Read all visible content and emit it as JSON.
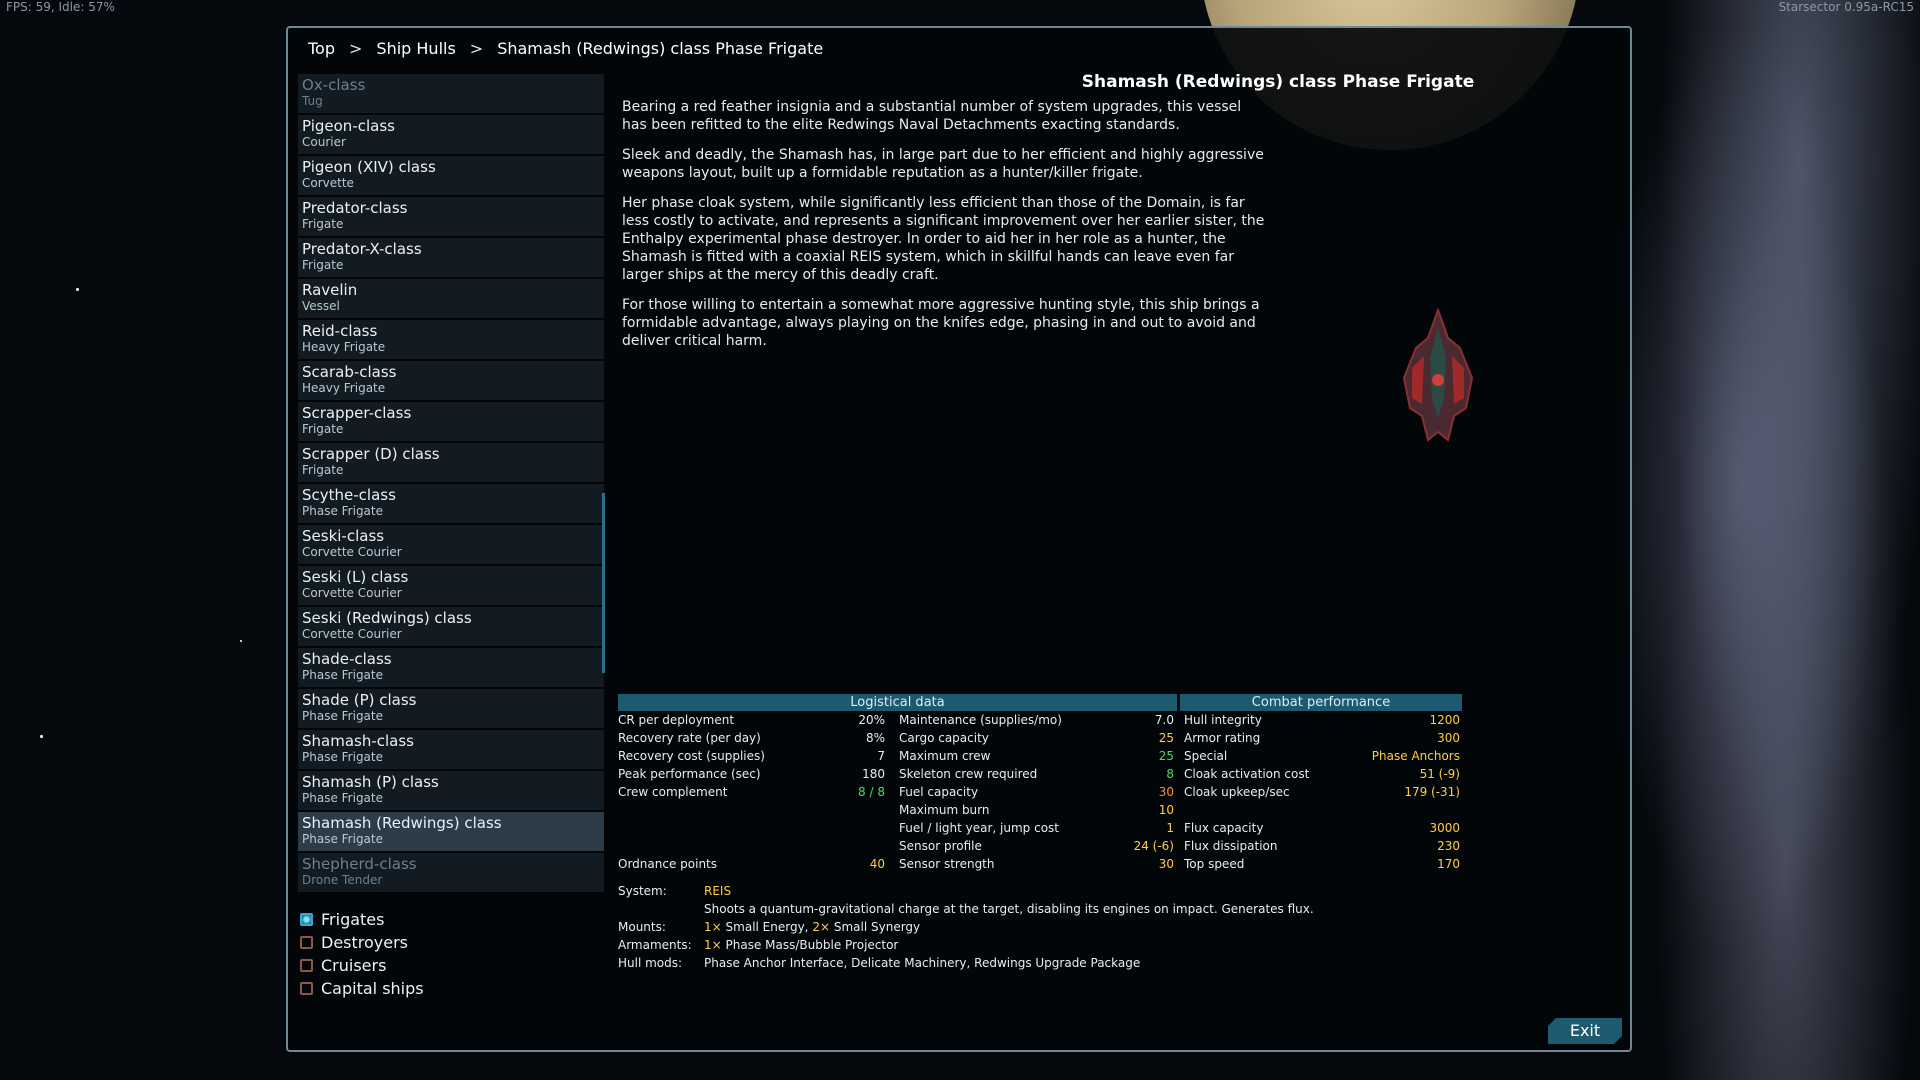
{
  "hud": {
    "fps": "FPS: 59, Idle: 57%",
    "version": "Starsector 0.95a-RC15"
  },
  "breadcrumbs": [
    "Top",
    ">",
    "Ship Hulls",
    ">",
    "Shamash (Redwings) class Phase Frigate"
  ],
  "ship_list": [
    {
      "name": "Ox-class",
      "type": "Tug"
    },
    {
      "name": "Pigeon-class",
      "type": "Courier"
    },
    {
      "name": "Pigeon (XIV) class",
      "type": "Corvette"
    },
    {
      "name": "Predator-class",
      "type": "Frigate"
    },
    {
      "name": "Predator-X-class",
      "type": "Frigate"
    },
    {
      "name": "Ravelin",
      "type": "Vessel"
    },
    {
      "name": "Reid-class",
      "type": "Heavy Frigate"
    },
    {
      "name": "Scarab-class",
      "type": "Heavy Frigate"
    },
    {
      "name": "Scrapper-class",
      "type": "Frigate"
    },
    {
      "name": "Scrapper (D) class",
      "type": "Frigate"
    },
    {
      "name": "Scythe-class",
      "type": "Phase Frigate"
    },
    {
      "name": "Seski-class",
      "type": "Corvette Courier"
    },
    {
      "name": "Seski (L) class",
      "type": "Corvette Courier"
    },
    {
      "name": "Seski (Redwings) class",
      "type": "Corvette Courier"
    },
    {
      "name": "Shade-class",
      "type": "Phase Frigate"
    },
    {
      "name": "Shade (P) class",
      "type": "Phase Frigate"
    },
    {
      "name": "Shamash-class",
      "type": "Phase Frigate"
    },
    {
      "name": "Shamash (P) class",
      "type": "Phase Frigate"
    },
    {
      "name": "Shamash (Redwings) class",
      "type": "Phase Frigate"
    },
    {
      "name": "Shepherd-class",
      "type": "Drone Tender"
    }
  ],
  "filters": [
    {
      "label": "Frigates",
      "checked": true
    },
    {
      "label": "Destroyers",
      "checked": false
    },
    {
      "label": "Cruisers",
      "checked": false
    },
    {
      "label": "Capital ships",
      "checked": false
    }
  ],
  "detail": {
    "title": "Shamash (Redwings) class Phase Frigate",
    "paragraphs": [
      "Bearing a red feather insignia and a substantial number of system upgrades, this vessel has been refitted to the elite Redwings Naval Detachments exacting standards.",
      "Sleek and deadly, the Shamash has, in large part due to her efficient and highly aggressive weapons layout, built up a formidable reputation as a hunter/killer frigate.",
      "Her phase cloak system, while significantly less efficient than those of the Domain, is far less costly to activate, and represents a significant improvement over her earlier sister, the Enthalpy experimental phase destroyer. In order to aid her in her role as a hunter, the Shamash is fitted with a coaxial REIS system, which in skillful hands can leave even far larger ships at the mercy of this deadly craft.",
      "For those willing to entertain a somewhat more aggressive hunting style, this ship brings a formidable advantage, always playing on the knifes edge, phasing in and out to avoid and deliver critical harm."
    ]
  },
  "stats": {
    "headers": {
      "logistical": "Logistical data",
      "combat": "Combat performance"
    },
    "col1": [
      {
        "label": "CR per deployment",
        "value": "20%"
      },
      {
        "label": "Recovery rate (per day)",
        "value": "8%"
      },
      {
        "label": "Recovery cost (supplies)",
        "value": "7"
      },
      {
        "label": "Peak performance (sec)",
        "value": "180"
      },
      {
        "label": "Crew complement",
        "value": "8 / 8"
      },
      {
        "label": "",
        "value": ""
      },
      {
        "label": "",
        "value": ""
      },
      {
        "label": "",
        "value": ""
      },
      {
        "label": "Ordnance points",
        "value": "40"
      }
    ],
    "col2": [
      {
        "label": "Maintenance (supplies/mo)",
        "value": "7.0"
      },
      {
        "label": "Cargo capacity",
        "value": "25"
      },
      {
        "label": "Maximum crew",
        "value": "25"
      },
      {
        "label": "Skeleton crew required",
        "value": "8"
      },
      {
        "label": "Fuel capacity",
        "value": "30"
      },
      {
        "label": "Maximum burn",
        "value": "10"
      },
      {
        "label": "Fuel / light year, jump cost",
        "value": "1"
      },
      {
        "label": "Sensor profile",
        "value": "24 (-6)"
      },
      {
        "label": "Sensor strength",
        "value": "30"
      }
    ],
    "col3": [
      {
        "label": "Hull integrity",
        "value": "1200"
      },
      {
        "label": "Armor rating",
        "value": "300"
      },
      {
        "label": "Special",
        "value": "Phase Anchors"
      },
      {
        "label": "Cloak activation cost",
        "value": "51 (-9)"
      },
      {
        "label": "Cloak upkeep/sec",
        "value": "179 (-31)"
      },
      {
        "label": "",
        "value": ""
      },
      {
        "label": "Flux capacity",
        "value": "3000"
      },
      {
        "label": "Flux dissipation",
        "value": "230"
      },
      {
        "label": "Top speed",
        "value": "170"
      }
    ]
  },
  "info": {
    "system_label": "System:",
    "system_name": "REIS",
    "system_desc": "Shoots a quantum-gravitational charge at the target, disabling its engines on impact. Generates flux.",
    "mounts_label": "Mounts:",
    "mounts_n1": "1×",
    "mounts_t1": "Small Energy,",
    "mounts_n2": "2×",
    "mounts_t2": "Small Synergy",
    "armaments_label": "Armaments:",
    "armaments_n": "1×",
    "armaments_t": "Phase Mass/Bubble Projector",
    "hullmods_label": "Hull mods:",
    "hullmods": "Phase Anchor Interface, Delicate Machinery, Redwings Upgrade Package"
  },
  "exit_label": "Exit",
  "colors": {
    "accent": "#1e5a70",
    "value_yellow": "#ffcc44",
    "value_green": "#44dd66",
    "value_orange": "#ff8844",
    "value_red": "#ff5544"
  }
}
